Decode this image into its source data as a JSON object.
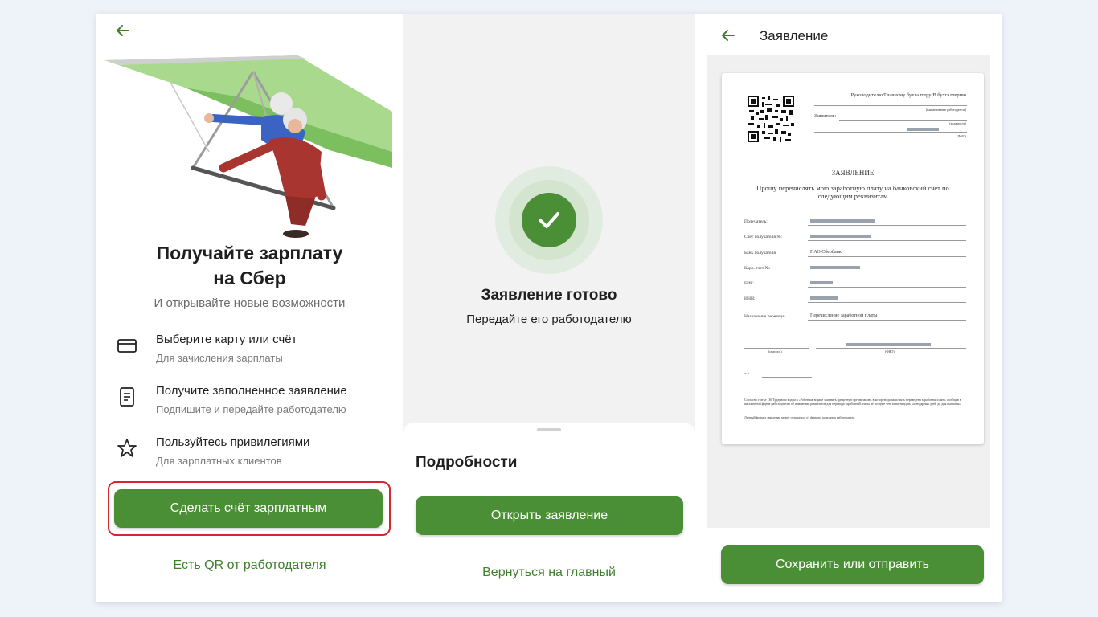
{
  "colors": {
    "brand_green": "#4a8f35",
    "link_green": "#3e7f2c",
    "highlight_red": "#d6262f"
  },
  "panel1": {
    "back_icon": "arrow-left-icon",
    "title_line1": "Получайте зарплату",
    "title_line2": "на Сбер",
    "subtitle": "И открывайте новые возможности",
    "features": [
      {
        "icon": "card-icon",
        "title": "Выберите карту или счёт",
        "subtitle": "Для зачисления зарплаты"
      },
      {
        "icon": "document-icon",
        "title": "Получите заполненное заявление",
        "subtitle": "Подпишите и передайте работодателю"
      },
      {
        "icon": "star-icon",
        "title": "Пользуйтесь привилегиями",
        "subtitle": "Для зарплатных клиентов"
      }
    ],
    "primary_button": "Сделать счёт зарплатным",
    "qr_link": "Есть QR от работодателя"
  },
  "panel2": {
    "status_icon": "check-icon",
    "status_title": "Заявление готово",
    "status_subtitle": "Передайте его работодателю",
    "sheet_title": "Подробности",
    "open_button": "Открыть заявление",
    "home_link": "Вернуться на главный"
  },
  "panel3": {
    "back_icon": "arrow-left-icon",
    "header_title": "Заявление",
    "save_button": "Сохранить или отправить",
    "doc": {
      "addressee": "Руководителю/Главному бухгалтеру/В бухгалтерию",
      "employer_caption": "(наименование работодателя)",
      "applicant_label": "Заявитель:",
      "position_caption": "(должность)",
      "fio_caption": "(ФИО)",
      "heading": "ЗАЯВЛЕНИЕ",
      "request_line1": "Прошу перечислять мою заработную плату на банковский счет по",
      "request_line2": "следующим реквизитам",
      "rows": [
        {
          "label": "Получатель:",
          "value": ""
        },
        {
          "label": "Счет получателя №:",
          "value": ""
        },
        {
          "label": "Банк получателя:",
          "value": "ПАО Сбербанк"
        },
        {
          "label": "Корр. счет №:",
          "value": ""
        },
        {
          "label": "БИК:",
          "value": ""
        },
        {
          "label": "ИНН:",
          "value": ""
        },
        {
          "label": "Назначение перевода:",
          "value": "Перечисление заработной платы"
        }
      ],
      "signature_caption": "(подпись)",
      "fio_short_caption": "(ФИО)",
      "date_marks": "«     »",
      "footnote1": "Согласно статье 136 Трудового кодекса «Работник вправе заменить кредитную организацию, в которую должна быть переведена заработная плата, сообщив в письменной форме работодателю об изменении реквизитов для перевода заработной платы не позднее чем за пятнадцать календарных дней до дня выплаты»",
      "footnote2": "Данный формат заявления может отличаться от формата компании работодателя."
    }
  }
}
